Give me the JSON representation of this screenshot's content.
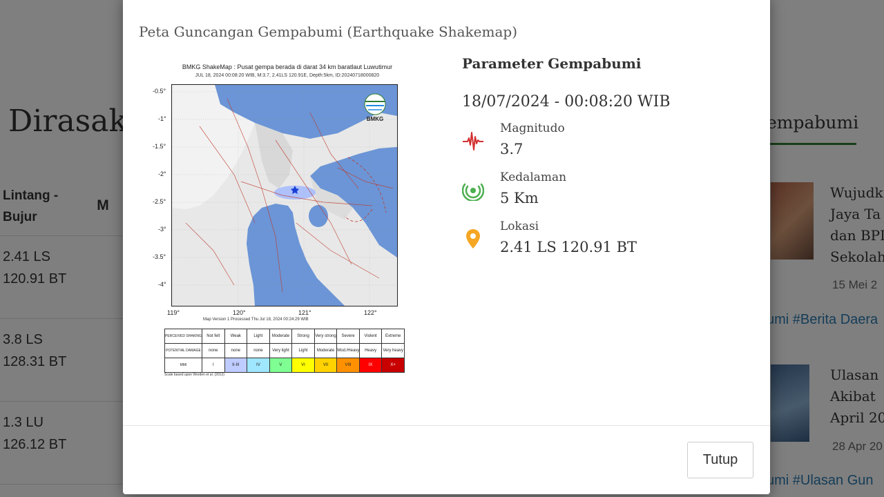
{
  "background": {
    "heading": "i Dirasak",
    "table": {
      "col_lintang_bujur_line1": "Lintang -",
      "col_lintang_bujur_line2": "Bujur",
      "col_m": "M",
      "rows": [
        {
          "lat": "2.41 LS",
          "lon": "120.91 BT"
        },
        {
          "lat": "3.8 LS",
          "lon": "128.31 BT"
        },
        {
          "lat": "1.3 LU",
          "lon": "126.12 BT"
        }
      ]
    },
    "right": {
      "tab": "empabumi",
      "news": [
        {
          "title_lines": [
            "Wujudk",
            "Jaya Ta",
            "dan BPI",
            "Sekolah"
          ],
          "date": "15 Mei 2",
          "tags": "umi #Berita Daera"
        },
        {
          "title_lines": [
            "Ulasan",
            "Akibat",
            "April 20"
          ],
          "date": "28 Apr 20",
          "tags": "umi #Ulasan Gun"
        }
      ]
    }
  },
  "modal": {
    "title": "Peta Guncangan Gempabumi (Earthquake Shakemap)",
    "close_label": "Tutup",
    "shakemap": {
      "title": "BMKG ShakeMap : Pusat gempa berada di darat 34 km baratlaut Luwutimur",
      "subtitle": "JUL 18, 2024 00:08:20 WIB, M:3.7, 2.41LS 120.91E, Depth:5km, ID:20240718000820",
      "logo_text": "BMKG",
      "y_ticks": [
        "-0.5°",
        "-1°",
        "-1.5°",
        "-2°",
        "-2.5°",
        "-3°",
        "-3.5°",
        "-4°"
      ],
      "x_ticks": [
        "119°",
        "120°",
        "121°",
        "122°"
      ],
      "version_note": "Map Version 1 Processed Thu Jul 18, 2024 00:24:29 WIB",
      "legend": {
        "rows": [
          {
            "header": "PERCEIVED SHAKING",
            "cells": [
              "Not felt",
              "Weak",
              "Light",
              "Moderate",
              "Strong",
              "Very strong",
              "Severe",
              "Violent",
              "Extreme"
            ]
          },
          {
            "header": "POTENTIAL DAMAGE",
            "cells": [
              "none",
              "none",
              "none",
              "Very light",
              "Light",
              "Moderate",
              "Mod./Heavy",
              "Heavy",
              "Very heavy"
            ]
          },
          {
            "header": "MMI",
            "cells": [
              "I",
              "II-III",
              "IV",
              "V",
              "VI",
              "VII",
              "VIII",
              "IX",
              "X+"
            ]
          }
        ],
        "colors": [
          "#ffffff",
          "#bfccff",
          "#9fe6ff",
          "#7fff93",
          "#ffff00",
          "#ffd200",
          "#ff9100",
          "#ff0000",
          "#c80000"
        ]
      },
      "footnote": "Scale based upon Worden et al. (2012)"
    },
    "params": {
      "title": "Parameter Gempabumi",
      "datetime": "18/07/2024 - 00:08:20 WIB",
      "magnitude_label": "Magnitudo",
      "magnitude_value": "3.7",
      "depth_label": "Kedalaman",
      "depth_value": "5 Km",
      "location_label": "Lokasi",
      "location_value": "2.41 LS 120.91 BT"
    },
    "icons": {
      "magnitude": "seismograph-icon",
      "depth": "depth-rings-icon",
      "location": "map-pin-icon"
    },
    "colors": {
      "magnitude_icon": "#d32f2f",
      "depth_icon": "#4caf50",
      "location_icon": "#f5a623"
    }
  }
}
